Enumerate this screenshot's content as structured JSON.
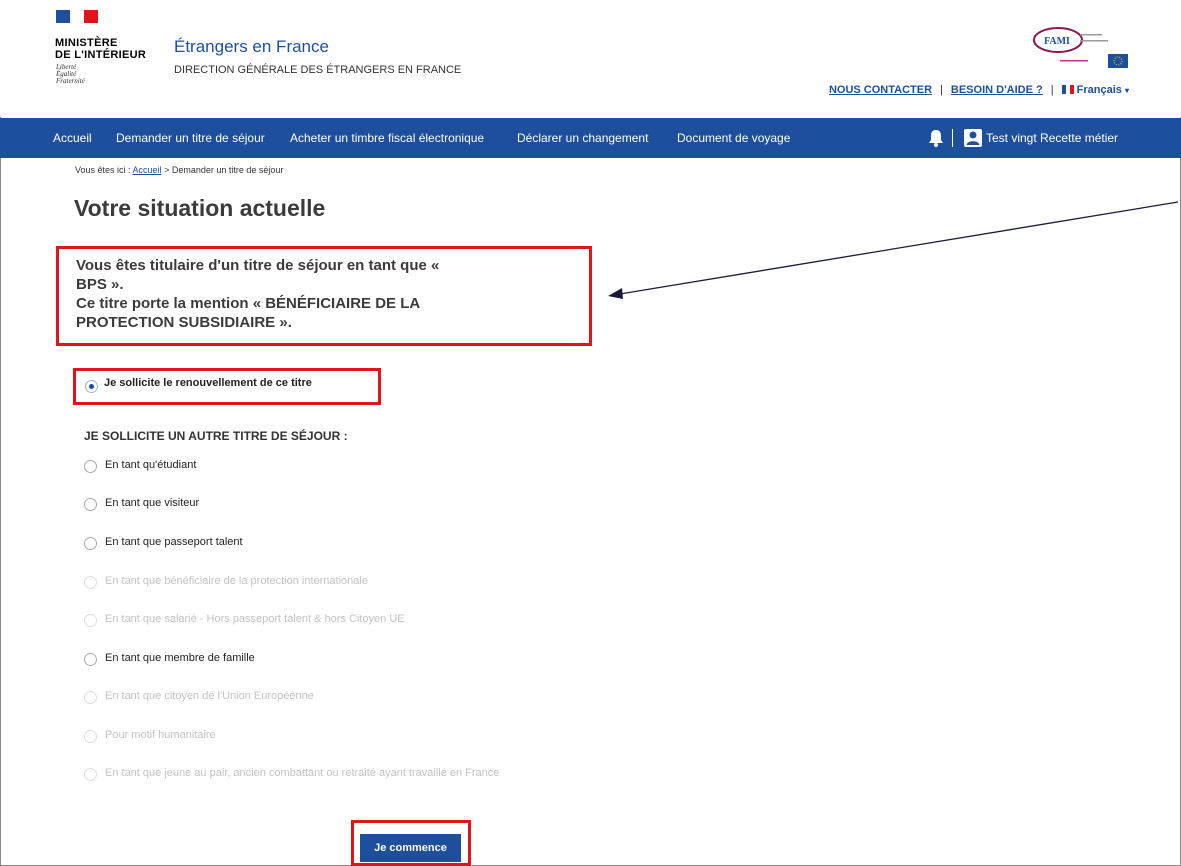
{
  "header": {
    "ministry_line1": "MINISTÈRE",
    "ministry_line2": "DE L'INTÉRIEUR",
    "motto": [
      "Liberté",
      "Égalité",
      "Fraternité"
    ],
    "site_title": "Étrangers en France",
    "site_subtitle": "DIRECTION GÉNÉRALE DES ÉTRANGERS EN FRANCE",
    "fami_logo": "FAMI",
    "contact_link": "NOUS CONTACTER",
    "help_link": "BESOIN D'AIDE ?",
    "separator": "|",
    "language": "Français"
  },
  "nav": {
    "items": [
      "Accueil",
      "Demander un titre de séjour",
      "Acheter un timbre fiscal électronique",
      "Déclarer un changement",
      "Document de voyage"
    ],
    "user_label": "Test vingt Recette métier"
  },
  "breadcrumb": {
    "prefix": "Vous êtes ici : ",
    "home": "Accueil",
    "current": " > Demander un titre de séjour"
  },
  "page": {
    "title": "Votre situation actuelle",
    "status_lines": [
      "Vous êtes titulaire d'un titre de séjour en tant que «",
      "BPS ».",
      "Ce titre porte la mention « BÉNÉFICIAIRE DE LA",
      "PROTECTION SUBSIDIAIRE »."
    ],
    "renew_option": "Je sollicite le renouvellement de ce titre",
    "other_heading": "JE SOLLICITE UN AUTRE TITRE DE SÉJOUR :",
    "other_options": [
      {
        "label": "En tant qu'étudiant",
        "enabled": true
      },
      {
        "label": "En tant que visiteur",
        "enabled": true
      },
      {
        "label": "En tant que passeport talent",
        "enabled": true
      },
      {
        "label": "En tant que bénéficiaire de la protection internationale",
        "enabled": false
      },
      {
        "label": "En tant que salarié - Hors passeport talent & hors Citoyen UE",
        "enabled": false
      },
      {
        "label": "En tant que membre de famille",
        "enabled": true
      },
      {
        "label": "En tant que citoyen de l'Union Européenne",
        "enabled": false
      },
      {
        "label": "Pour motif humanitaire",
        "enabled": false
      },
      {
        "label": "En tant que jeune au pair, ancien combattant ou retraité ayant travaillé en France",
        "enabled": false
      }
    ],
    "start_button": "Je commence"
  },
  "colors": {
    "brand_blue": "#1d4f9c",
    "highlight_red": "#e1141c",
    "disabled_text": "#c3c3c3"
  }
}
